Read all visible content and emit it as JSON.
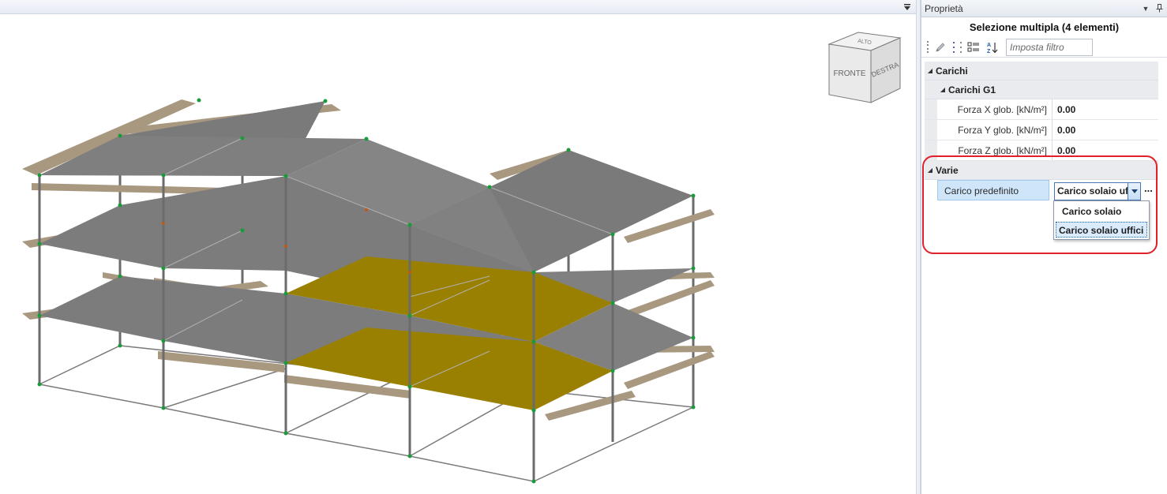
{
  "panel": {
    "title": "Proprietà",
    "selection_title": "Selezione multipla (4 elementi)",
    "filter_placeholder": "Imposta filtro"
  },
  "grid": {
    "category_loads": "Carichi",
    "subcategory_g1": "Carichi G1",
    "rows": [
      {
        "name": "Forza X glob. [kN/m²]",
        "value": "0.00"
      },
      {
        "name": "Forza Y glob. [kN/m²]",
        "value": "0.00"
      },
      {
        "name": "Forza Z glob. [kN/m²]",
        "value": "0.00"
      }
    ],
    "category_misc": "Varie",
    "default_load_label": "Carico predefinito",
    "default_load_value": "Carico solaio uffici",
    "ellipsis": "..."
  },
  "dropdown": {
    "options": [
      "Carico solaio",
      "Carico solaio uffici"
    ],
    "highlighted_index": 1
  },
  "viewcube": {
    "front": "FRONTE",
    "right": "DESTRA",
    "top": "ALTO"
  },
  "colors": {
    "slab": "#7a7a7a",
    "slab_selected": "#9a8000",
    "beam": "#a89880",
    "column": "#6b6b6b",
    "node": "#1a9a3a",
    "highlight_ring": "#e0202a"
  }
}
